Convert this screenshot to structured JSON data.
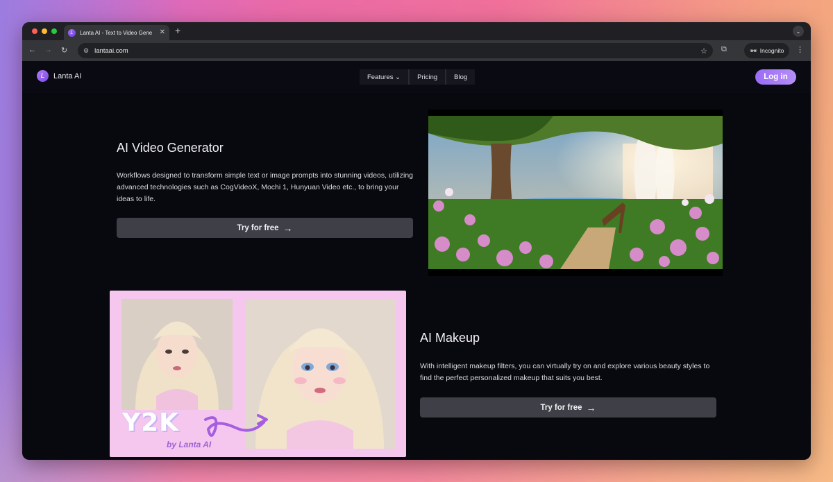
{
  "browser": {
    "tab_title": "Lanta AI - Text to Video Gene",
    "tab_close": "✕",
    "new_tab": "+",
    "url": "lantaai.com",
    "incognito_label": "Incognito"
  },
  "site": {
    "brand_name": "Lanta AI",
    "brand_logo_letter": "L",
    "nav": [
      {
        "label": "Features ⌄"
      },
      {
        "label": "Pricing"
      },
      {
        "label": "Blog"
      }
    ],
    "login_label": "Log in"
  },
  "sections": [
    {
      "title": "AI Video Generator",
      "description": "Workflows designed to transform simple text or image prompts into stunning videos, utilizing advanced technologies such as CogVideoX, Mochi 1, Hunyuan Video etc., to bring your ideas to life.",
      "cta": "Try for free",
      "cta_arrow": "→"
    },
    {
      "title": "AI Makeup",
      "description": "With intelligent makeup filters, you can virtually try on and explore various beauty styles to find the perfect personalized makeup that suits you best.",
      "cta": "Try for free",
      "cta_arrow": "→",
      "image_caption": "Y2K",
      "image_byline": "by Lanta AI"
    }
  ],
  "colors": {
    "accent": "#9b6cf5",
    "page_bg": "#08080f",
    "button_bg": "#3f3f48",
    "card_bg": "#f6c7ee"
  },
  "icons": [
    "back-arrow-icon",
    "forward-arrow-icon",
    "reload-icon",
    "site-info-icon",
    "star-icon",
    "extensions-icon",
    "incognito-icon",
    "menu-kebab-icon"
  ]
}
